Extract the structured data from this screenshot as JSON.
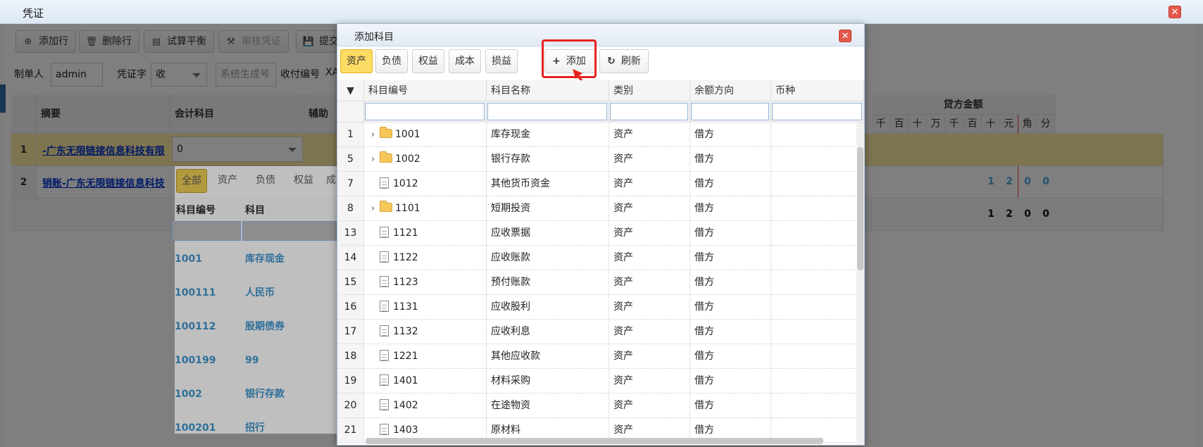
{
  "window": {
    "title": "凭证"
  },
  "toolbar": {
    "add_row": "添加行",
    "delete_row": "删除行",
    "trial_balance": "试算平衡",
    "review": "审核凭证",
    "submit": "提交"
  },
  "form": {
    "maker_label": "制单人",
    "maker_value": "admin",
    "voucher_word_label": "凭证字",
    "voucher_word_value": "收",
    "voucher_no_placeholder": "系统生成号",
    "receipt_no_label": "收付编号",
    "receipt_no_value": "XA"
  },
  "voucher": {
    "col_summary": "摘要",
    "col_account": "会计科目",
    "col_aux": "辅助",
    "col_credit": "贷方金额",
    "digit_headers": [
      "千",
      "百",
      "十",
      "万",
      "千",
      "百",
      "十",
      "元",
      "角",
      "分"
    ],
    "rows": [
      {
        "num": "1",
        "summary": "-广东无限链接信息科技有限",
        "account": "0"
      },
      {
        "num": "2",
        "summary": "销账-广东无限链接信息科技",
        "account": ""
      }
    ],
    "row2_credit_digits": [
      "1",
      "2",
      "0",
      "0"
    ],
    "total_digits": [
      "1",
      "2",
      "0",
      "0"
    ]
  },
  "popup": {
    "tabs": [
      "全部",
      "资产",
      "负债",
      "权益",
      "成"
    ],
    "col_code": "科目编号",
    "col_name": "科目",
    "items": [
      {
        "code": "1001",
        "name": "库存现金"
      },
      {
        "code": "100111",
        "name": "人民币"
      },
      {
        "code": "100112",
        "name": "股期债券"
      },
      {
        "code": "100199",
        "name": "99"
      },
      {
        "code": "1002",
        "name": "银行存款"
      },
      {
        "code": "100201",
        "name": "招行"
      }
    ]
  },
  "modal": {
    "title": "添加科目",
    "tabs": [
      "资产",
      "负债",
      "权益",
      "成本",
      "损益"
    ],
    "add_label": "添加",
    "refresh_label": "刷新",
    "columns": {
      "code": "科目编号",
      "name": "科目名称",
      "category": "类别",
      "balance_dir": "余额方向",
      "currency": "币种"
    },
    "rows": [
      {
        "num": "1",
        "code": "1001",
        "name": "库存现金",
        "category": "资产",
        "dir": "借方",
        "folder": true
      },
      {
        "num": "5",
        "code": "1002",
        "name": "银行存款",
        "category": "资产",
        "dir": "借方",
        "folder": true
      },
      {
        "num": "7",
        "code": "1012",
        "name": "其他货币资金",
        "category": "资产",
        "dir": "借方",
        "folder": false
      },
      {
        "num": "8",
        "code": "1101",
        "name": "短期投资",
        "category": "资产",
        "dir": "借方",
        "folder": true
      },
      {
        "num": "13",
        "code": "1121",
        "name": "应收票据",
        "category": "资产",
        "dir": "借方",
        "folder": false
      },
      {
        "num": "14",
        "code": "1122",
        "name": "应收账款",
        "category": "资产",
        "dir": "借方",
        "folder": false
      },
      {
        "num": "15",
        "code": "1123",
        "name": "预付账款",
        "category": "资产",
        "dir": "借方",
        "folder": false
      },
      {
        "num": "16",
        "code": "1131",
        "name": "应收股利",
        "category": "资产",
        "dir": "借方",
        "folder": false
      },
      {
        "num": "17",
        "code": "1132",
        "name": "应收利息",
        "category": "资产",
        "dir": "借方",
        "folder": false
      },
      {
        "num": "18",
        "code": "1221",
        "name": "其他应收款",
        "category": "资产",
        "dir": "借方",
        "folder": false
      },
      {
        "num": "19",
        "code": "1401",
        "name": "材料采购",
        "category": "资产",
        "dir": "借方",
        "folder": false
      },
      {
        "num": "20",
        "code": "1402",
        "name": "在途物资",
        "category": "资产",
        "dir": "借方",
        "folder": false
      },
      {
        "num": "21",
        "code": "1403",
        "name": "原材料",
        "category": "资产",
        "dir": "借方",
        "folder": false
      }
    ]
  }
}
